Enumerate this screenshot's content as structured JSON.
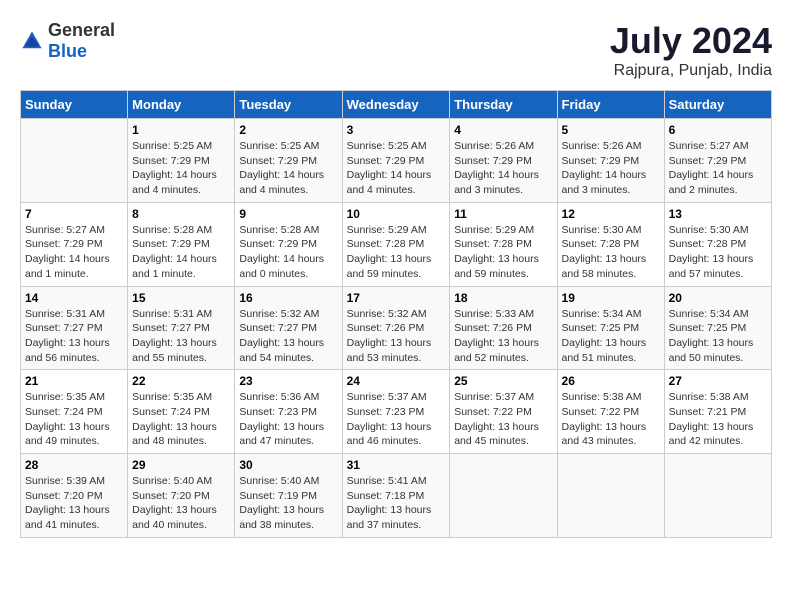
{
  "logo": {
    "text_general": "General",
    "text_blue": "Blue"
  },
  "title": "July 2024",
  "subtitle": "Rajpura, Punjab, India",
  "days_header": [
    "Sunday",
    "Monday",
    "Tuesday",
    "Wednesday",
    "Thursday",
    "Friday",
    "Saturday"
  ],
  "weeks": [
    [
      {
        "day": "",
        "sunrise": "",
        "sunset": "",
        "daylight": ""
      },
      {
        "day": "1",
        "sunrise": "Sunrise: 5:25 AM",
        "sunset": "Sunset: 7:29 PM",
        "daylight": "Daylight: 14 hours and 4 minutes."
      },
      {
        "day": "2",
        "sunrise": "Sunrise: 5:25 AM",
        "sunset": "Sunset: 7:29 PM",
        "daylight": "Daylight: 14 hours and 4 minutes."
      },
      {
        "day": "3",
        "sunrise": "Sunrise: 5:25 AM",
        "sunset": "Sunset: 7:29 PM",
        "daylight": "Daylight: 14 hours and 4 minutes."
      },
      {
        "day": "4",
        "sunrise": "Sunrise: 5:26 AM",
        "sunset": "Sunset: 7:29 PM",
        "daylight": "Daylight: 14 hours and 3 minutes."
      },
      {
        "day": "5",
        "sunrise": "Sunrise: 5:26 AM",
        "sunset": "Sunset: 7:29 PM",
        "daylight": "Daylight: 14 hours and 3 minutes."
      },
      {
        "day": "6",
        "sunrise": "Sunrise: 5:27 AM",
        "sunset": "Sunset: 7:29 PM",
        "daylight": "Daylight: 14 hours and 2 minutes."
      }
    ],
    [
      {
        "day": "7",
        "sunrise": "Sunrise: 5:27 AM",
        "sunset": "Sunset: 7:29 PM",
        "daylight": "Daylight: 14 hours and 1 minute."
      },
      {
        "day": "8",
        "sunrise": "Sunrise: 5:28 AM",
        "sunset": "Sunset: 7:29 PM",
        "daylight": "Daylight: 14 hours and 1 minute."
      },
      {
        "day": "9",
        "sunrise": "Sunrise: 5:28 AM",
        "sunset": "Sunset: 7:29 PM",
        "daylight": "Daylight: 14 hours and 0 minutes."
      },
      {
        "day": "10",
        "sunrise": "Sunrise: 5:29 AM",
        "sunset": "Sunset: 7:28 PM",
        "daylight": "Daylight: 13 hours and 59 minutes."
      },
      {
        "day": "11",
        "sunrise": "Sunrise: 5:29 AM",
        "sunset": "Sunset: 7:28 PM",
        "daylight": "Daylight: 13 hours and 59 minutes."
      },
      {
        "day": "12",
        "sunrise": "Sunrise: 5:30 AM",
        "sunset": "Sunset: 7:28 PM",
        "daylight": "Daylight: 13 hours and 58 minutes."
      },
      {
        "day": "13",
        "sunrise": "Sunrise: 5:30 AM",
        "sunset": "Sunset: 7:28 PM",
        "daylight": "Daylight: 13 hours and 57 minutes."
      }
    ],
    [
      {
        "day": "14",
        "sunrise": "Sunrise: 5:31 AM",
        "sunset": "Sunset: 7:27 PM",
        "daylight": "Daylight: 13 hours and 56 minutes."
      },
      {
        "day": "15",
        "sunrise": "Sunrise: 5:31 AM",
        "sunset": "Sunset: 7:27 PM",
        "daylight": "Daylight: 13 hours and 55 minutes."
      },
      {
        "day": "16",
        "sunrise": "Sunrise: 5:32 AM",
        "sunset": "Sunset: 7:27 PM",
        "daylight": "Daylight: 13 hours and 54 minutes."
      },
      {
        "day": "17",
        "sunrise": "Sunrise: 5:32 AM",
        "sunset": "Sunset: 7:26 PM",
        "daylight": "Daylight: 13 hours and 53 minutes."
      },
      {
        "day": "18",
        "sunrise": "Sunrise: 5:33 AM",
        "sunset": "Sunset: 7:26 PM",
        "daylight": "Daylight: 13 hours and 52 minutes."
      },
      {
        "day": "19",
        "sunrise": "Sunrise: 5:34 AM",
        "sunset": "Sunset: 7:25 PM",
        "daylight": "Daylight: 13 hours and 51 minutes."
      },
      {
        "day": "20",
        "sunrise": "Sunrise: 5:34 AM",
        "sunset": "Sunset: 7:25 PM",
        "daylight": "Daylight: 13 hours and 50 minutes."
      }
    ],
    [
      {
        "day": "21",
        "sunrise": "Sunrise: 5:35 AM",
        "sunset": "Sunset: 7:24 PM",
        "daylight": "Daylight: 13 hours and 49 minutes."
      },
      {
        "day": "22",
        "sunrise": "Sunrise: 5:35 AM",
        "sunset": "Sunset: 7:24 PM",
        "daylight": "Daylight: 13 hours and 48 minutes."
      },
      {
        "day": "23",
        "sunrise": "Sunrise: 5:36 AM",
        "sunset": "Sunset: 7:23 PM",
        "daylight": "Daylight: 13 hours and 47 minutes."
      },
      {
        "day": "24",
        "sunrise": "Sunrise: 5:37 AM",
        "sunset": "Sunset: 7:23 PM",
        "daylight": "Daylight: 13 hours and 46 minutes."
      },
      {
        "day": "25",
        "sunrise": "Sunrise: 5:37 AM",
        "sunset": "Sunset: 7:22 PM",
        "daylight": "Daylight: 13 hours and 45 minutes."
      },
      {
        "day": "26",
        "sunrise": "Sunrise: 5:38 AM",
        "sunset": "Sunset: 7:22 PM",
        "daylight": "Daylight: 13 hours and 43 minutes."
      },
      {
        "day": "27",
        "sunrise": "Sunrise: 5:38 AM",
        "sunset": "Sunset: 7:21 PM",
        "daylight": "Daylight: 13 hours and 42 minutes."
      }
    ],
    [
      {
        "day": "28",
        "sunrise": "Sunrise: 5:39 AM",
        "sunset": "Sunset: 7:20 PM",
        "daylight": "Daylight: 13 hours and 41 minutes."
      },
      {
        "day": "29",
        "sunrise": "Sunrise: 5:40 AM",
        "sunset": "Sunset: 7:20 PM",
        "daylight": "Daylight: 13 hours and 40 minutes."
      },
      {
        "day": "30",
        "sunrise": "Sunrise: 5:40 AM",
        "sunset": "Sunset: 7:19 PM",
        "daylight": "Daylight: 13 hours and 38 minutes."
      },
      {
        "day": "31",
        "sunrise": "Sunrise: 5:41 AM",
        "sunset": "Sunset: 7:18 PM",
        "daylight": "Daylight: 13 hours and 37 minutes."
      },
      {
        "day": "",
        "sunrise": "",
        "sunset": "",
        "daylight": ""
      },
      {
        "day": "",
        "sunrise": "",
        "sunset": "",
        "daylight": ""
      },
      {
        "day": "",
        "sunrise": "",
        "sunset": "",
        "daylight": ""
      }
    ]
  ]
}
